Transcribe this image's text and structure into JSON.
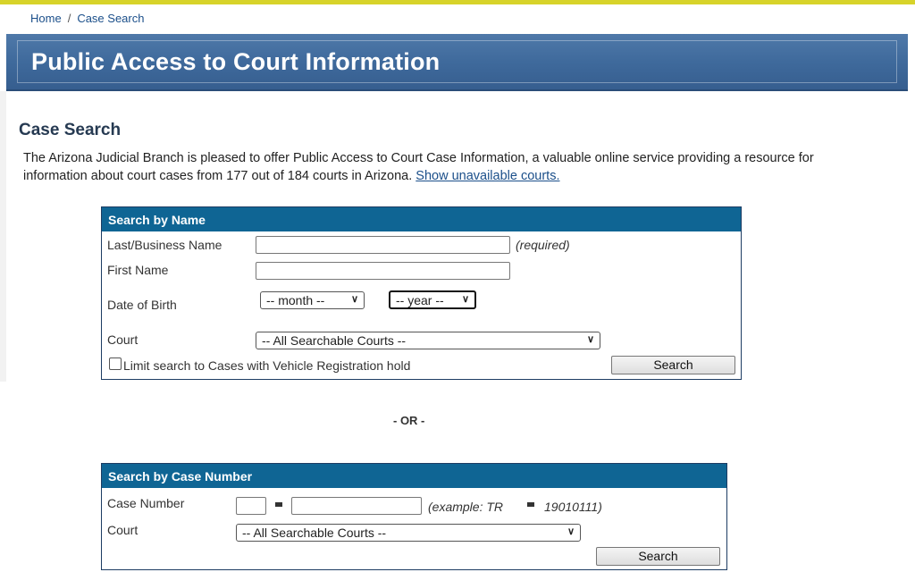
{
  "breadcrumb": {
    "home": "Home",
    "separator": "/",
    "current": "Case Search"
  },
  "banner": {
    "title": "Public Access to Court Information"
  },
  "section": {
    "title": "Case Search",
    "intro": "The Arizona Judicial Branch is pleased to offer Public Access to Court Case Information, a valuable online service providing a resource for information about court cases from 177 out of 184 courts in Arizona.",
    "link": "Show unavailable courts."
  },
  "search_by_name": {
    "header": "Search by Name",
    "last_label": "Last/Business Name",
    "required_hint": "(required)",
    "first_label": "First Name",
    "dob_label": "Date of Birth",
    "month_select": "-- month --",
    "year_select": "-- year --",
    "court_label": "Court",
    "court_select": "-- All Searchable Courts --",
    "vehicle_checkbox_label": "Limit search to Cases with Vehicle Registration hold",
    "search_button": "Search"
  },
  "or_divider": "- OR -",
  "search_by_case": {
    "header": "Search by Case Number",
    "case_label": "Case Number",
    "example_prefix": "(example: TR",
    "example_suffix": "19010111)",
    "court_label": "Court",
    "court_select": "-- All Searchable Courts --",
    "search_button": "Search"
  },
  "colors": {
    "accent_bar": "#d7d32a",
    "banner": "#3f6a9c",
    "panel_header": "#0f6594",
    "link": "#1b4f8a"
  }
}
